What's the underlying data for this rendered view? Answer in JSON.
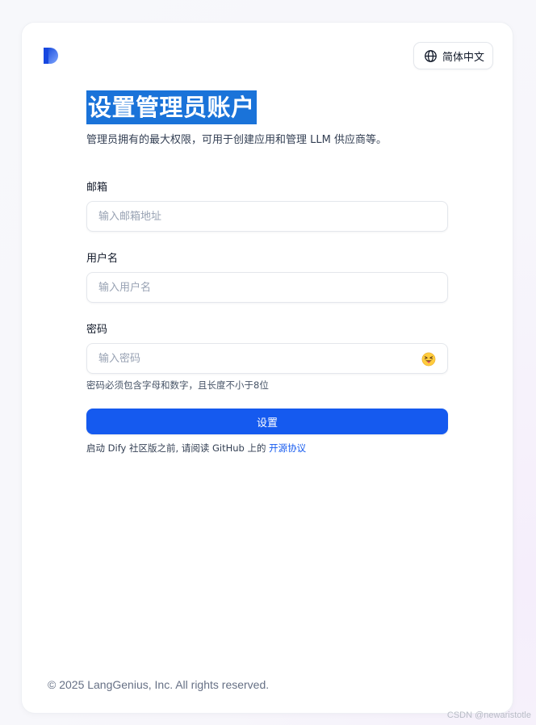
{
  "header": {
    "logo_icon": "dify-logo-icon",
    "language_button": {
      "icon": "globe-icon",
      "label": "简体中文"
    }
  },
  "form": {
    "title": "设置管理员账户",
    "subtitle": "管理员拥有的最大权限，可用于创建应用和管理 LLM 供应商等。",
    "email": {
      "label": "邮箱",
      "placeholder": "输入邮箱地址",
      "value": ""
    },
    "username": {
      "label": "用户名",
      "placeholder": "输入用户名",
      "value": ""
    },
    "password": {
      "label": "密码",
      "placeholder": "输入密码",
      "value": "",
      "toggle_icon": "emoji-face-icon",
      "hint": "密码必须包含字母和数字，且长度不小于8位"
    },
    "submit_label": "设置",
    "notice_prefix": "启动 Dify 社区版之前, 请阅读 GitHub 上的 ",
    "notice_link": "开源协议"
  },
  "footer": {
    "copyright": "© 2025 LangGenius, Inc. All rights reserved."
  },
  "watermark": "CSDN @newaristotle",
  "colors": {
    "primary": "#155aef",
    "title_highlight": "#1a73d9",
    "text": "#101828",
    "muted": "#667085"
  }
}
